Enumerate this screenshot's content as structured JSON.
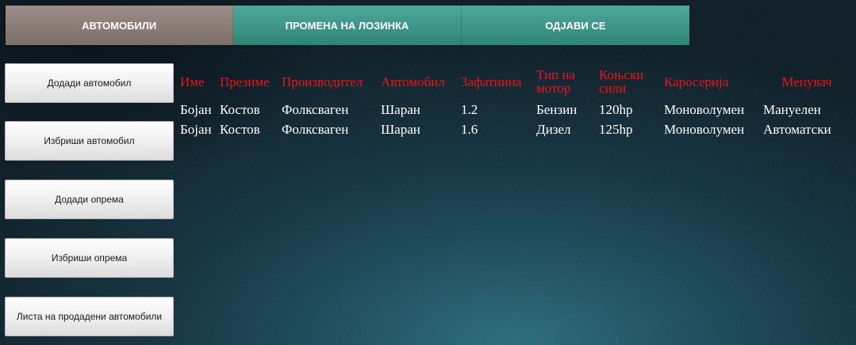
{
  "nav": {
    "items": [
      {
        "label": "АВТОМОБИЛИ"
      },
      {
        "label": "ПРОМЕНА НА ЛОЗИНКА"
      },
      {
        "label": "ОДЈАВИ СЕ"
      }
    ]
  },
  "sidebar": {
    "items": [
      {
        "label": "Додади автомобил"
      },
      {
        "label": "Избриши автомобил"
      },
      {
        "label": "Додади опрема"
      },
      {
        "label": "Избриши опрема"
      },
      {
        "label": "Листа на продадени автомобили"
      }
    ]
  },
  "table": {
    "headers": [
      "Име",
      "Презиме",
      "Производител",
      "Автомобил",
      "Зафатнина",
      "Тип на мотор",
      "Коњски сили",
      "Каросерија",
      "Менувач"
    ],
    "rows": [
      [
        "Бојан",
        "Костов",
        "Фолксваген",
        "Шаран",
        "1.2",
        "Бензин",
        "120hp",
        "Моноволумен",
        "Мануелен"
      ],
      [
        "Бојан",
        "Костов",
        "Фолксваген",
        "Шаран",
        "1.6",
        "Дизел",
        "125hp",
        "Моноволумен",
        "Автоматски"
      ]
    ]
  },
  "colors": {
    "header_text": "#e8141c",
    "nav_active": "#8a7c76",
    "nav_teal": "#3e9a8c"
  }
}
